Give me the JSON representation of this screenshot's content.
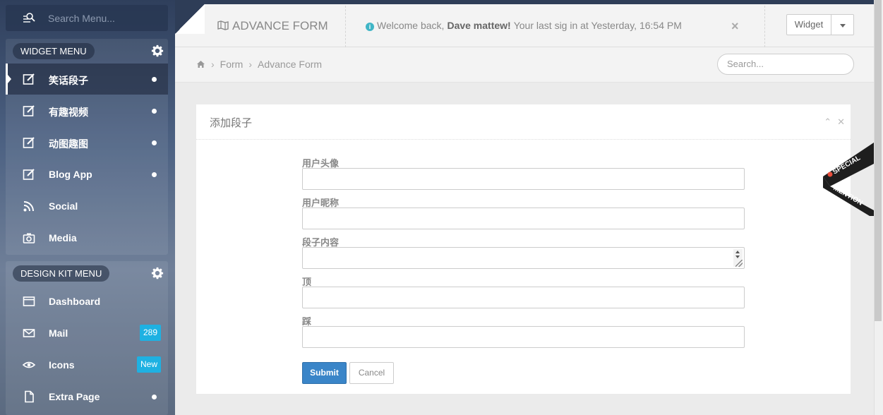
{
  "sidebar": {
    "search_placeholder": "Search Menu...",
    "widget_menu": {
      "title": "WIDGET MENU",
      "items": [
        {
          "label": "笑话段子",
          "icon": "edit-icon",
          "indicator": "dot",
          "active": true
        },
        {
          "label": "有趣视频",
          "icon": "edit-icon",
          "indicator": "dot"
        },
        {
          "label": "动图趣图",
          "icon": "edit-icon",
          "indicator": "dot"
        },
        {
          "label": "Blog App",
          "icon": "edit-icon",
          "indicator": "dot"
        },
        {
          "label": "Social",
          "icon": "rss-icon"
        },
        {
          "label": "Media",
          "icon": "camera-icon"
        }
      ]
    },
    "design_kit_menu": {
      "title": "DESIGN KIT MENU",
      "items": [
        {
          "label": "Dashboard",
          "icon": "window-icon"
        },
        {
          "label": "Mail",
          "icon": "mail-icon",
          "badge": "289"
        },
        {
          "label": "Icons",
          "icon": "eye-icon",
          "badge": "New"
        },
        {
          "label": "Extra Page",
          "icon": "file-icon",
          "indicator": "dot"
        }
      ]
    }
  },
  "topbar": {
    "brand": "ADVANCE FORM",
    "welcome_prefix": "Welcome back,",
    "user_name": "Dave mattew!",
    "welcome_suffix": "Your last sig in at Yesterday, 16:54 PM",
    "widget_label": "Widget"
  },
  "breadcrumb": {
    "items": [
      "Form",
      "Advance Form"
    ],
    "search_placeholder": "Search..."
  },
  "form": {
    "title": "添加段子",
    "fields": [
      {
        "label": "用户头像",
        "value": ""
      },
      {
        "label": "用户昵称",
        "value": ""
      },
      {
        "label": "段子内容",
        "value": ""
      },
      {
        "label": "顶",
        "value": ""
      },
      {
        "label": "踩",
        "value": ""
      }
    ],
    "submit_label": "Submit",
    "cancel_label": "Cancel"
  },
  "ribbon": {
    "line1": "SPECIAL",
    "line2": "MENTION"
  },
  "colors": {
    "accent": "#3a85c8",
    "badge": "#1eb1e2",
    "sidebar_top": "#2f3f5c"
  }
}
